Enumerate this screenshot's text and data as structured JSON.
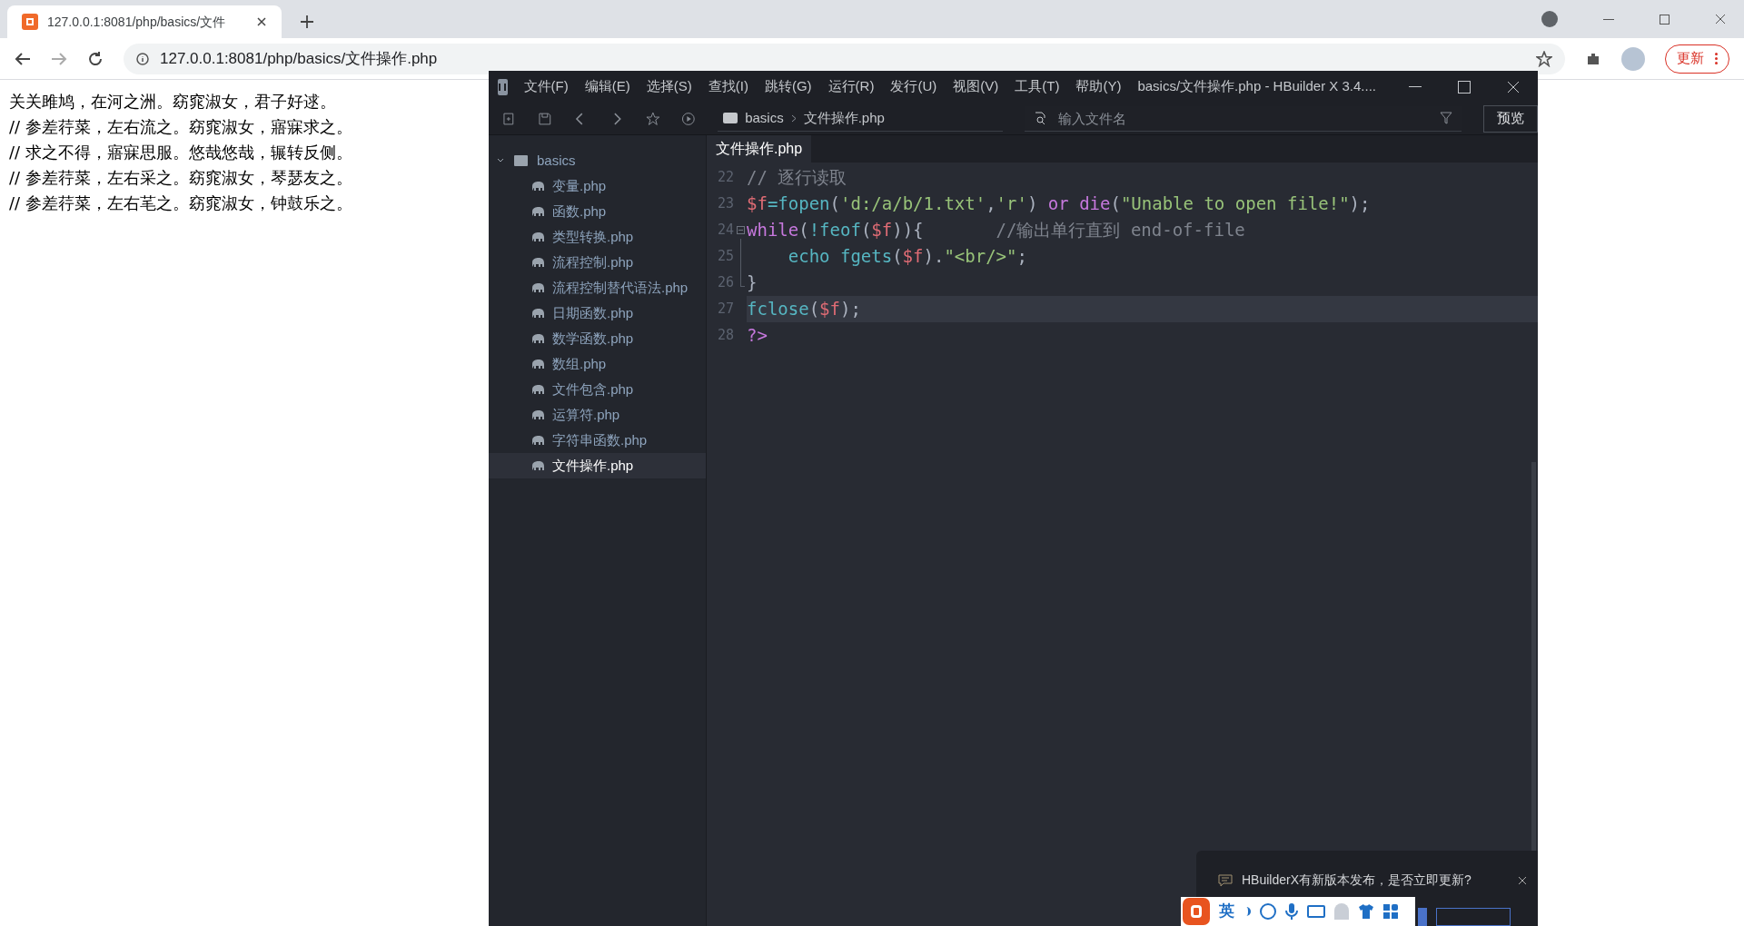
{
  "browser": {
    "tab": {
      "title": "127.0.0.1:8081/php/basics/文件"
    },
    "address": "127.0.0.1:8081/php/basics/文件操作.php",
    "update_button": "更新"
  },
  "page_lines": [
    "关关雎鸠，在河之洲。窈窕淑女，君子好逑。",
    "// 参差荇菜，左右流之。窈窕淑女，寤寐求之。",
    "// 求之不得，寤寐思服。悠哉悠哉，辗转反侧。",
    "// 参差荇菜，左右采之。窈窕淑女，琴瑟友之。",
    "// 参差荇菜，左右芼之。窈窕淑女，钟鼓乐之。"
  ],
  "editor": {
    "menu": [
      "文件(F)",
      "编辑(E)",
      "选择(S)",
      "查找(I)",
      "跳转(G)",
      "运行(R)",
      "发行(U)",
      "视图(V)",
      "工具(T)",
      "帮助(Y)"
    ],
    "title": "basics/文件操作.php - HBuilder X 3.4....",
    "breadcrumb": [
      "basics",
      "文件操作.php"
    ],
    "file_search": {
      "placeholder": "输入文件名"
    },
    "preview_button": "预览",
    "tree": {
      "label": "basics",
      "expanded": true,
      "children": [
        {
          "label": "变量.php",
          "selected": false
        },
        {
          "label": "函数.php",
          "selected": false
        },
        {
          "label": "类型转换.php",
          "selected": false
        },
        {
          "label": "流程控制.php",
          "selected": false
        },
        {
          "label": "流程控制替代语法.php",
          "selected": false
        },
        {
          "label": "日期函数.php",
          "selected": false
        },
        {
          "label": "数学函数.php",
          "selected": false
        },
        {
          "label": "数组.php",
          "selected": false
        },
        {
          "label": "文件包含.php",
          "selected": false
        },
        {
          "label": "运算符.php",
          "selected": false
        },
        {
          "label": "字符串函数.php",
          "selected": false
        },
        {
          "label": "文件操作.php",
          "selected": true
        }
      ]
    },
    "open_tab": {
      "title": "文件操作.php",
      "selected": true
    },
    "code": [
      {
        "number": "22",
        "tokens": [
          {
            "kind": "comment",
            "text": "// 逐行读取"
          }
        ]
      },
      {
        "number": "23",
        "tokens": [
          {
            "kind": "var",
            "text": "$f"
          },
          {
            "kind": "op",
            "text": "="
          },
          {
            "kind": "func",
            "text": "fopen"
          },
          {
            "kind": "punct",
            "text": "("
          },
          {
            "kind": "string",
            "text": "'d:/a/b/1.txt'"
          },
          {
            "kind": "punct",
            "text": ","
          },
          {
            "kind": "string",
            "text": "'r'"
          },
          {
            "kind": "punct",
            "text": ") "
          },
          {
            "kind": "keyword",
            "text": "or die"
          },
          {
            "kind": "punct",
            "text": "("
          },
          {
            "kind": "string",
            "text": "\"Unable to open file!\""
          },
          {
            "kind": "punct",
            "text": ");"
          }
        ]
      },
      {
        "number": "24",
        "expanded": true,
        "tokens": [
          {
            "kind": "keyword",
            "text": "while"
          },
          {
            "kind": "punct",
            "text": "("
          },
          {
            "kind": "op",
            "text": "!"
          },
          {
            "kind": "func",
            "text": "feof"
          },
          {
            "kind": "punct",
            "text": "("
          },
          {
            "kind": "var",
            "text": "$f"
          },
          {
            "kind": "punct",
            "text": ")){       "
          },
          {
            "kind": "comment",
            "text": "//输出单行直到 end-of-file"
          }
        ]
      },
      {
        "number": "25",
        "tokens": [
          {
            "kind": "func",
            "text": "    echo fgets"
          },
          {
            "kind": "punct",
            "text": "("
          },
          {
            "kind": "var",
            "text": "$f"
          },
          {
            "kind": "punct",
            "text": ")."
          },
          {
            "kind": "string",
            "text": "\"<br/>\""
          },
          {
            "kind": "punct",
            "text": ";"
          }
        ]
      },
      {
        "number": "26",
        "tokens": [
          {
            "kind": "punct",
            "text": "}"
          }
        ]
      },
      {
        "number": "27",
        "current": true,
        "tokens": [
          {
            "kind": "func",
            "text": "fclose"
          },
          {
            "kind": "punct",
            "text": "("
          },
          {
            "kind": "var",
            "text": "$f"
          },
          {
            "kind": "punct",
            "text": ");"
          }
        ]
      },
      {
        "number": "28",
        "tokens": [
          {
            "kind": "keyword",
            "text": "?>"
          }
        ]
      }
    ],
    "notification": {
      "message": "HBuilderX有新版本发布，是否立即更新?"
    }
  },
  "ime": {
    "mode": "英"
  }
}
